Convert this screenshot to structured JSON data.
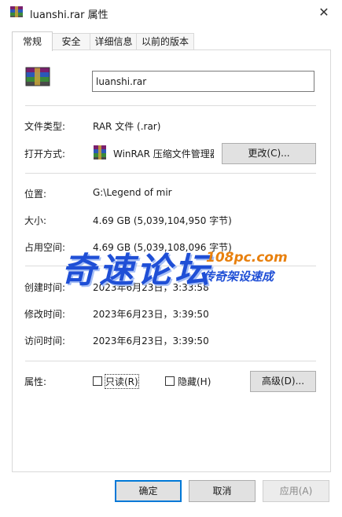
{
  "window": {
    "title": "luanshi.rar 属性",
    "close_glyph": "✕"
  },
  "tabs": [
    {
      "label": "常规",
      "active": true
    },
    {
      "label": "安全",
      "active": false
    },
    {
      "label": "详细信息",
      "active": false
    },
    {
      "label": "以前的版本",
      "active": false
    }
  ],
  "general": {
    "file_name": "luanshi.rar",
    "file_type_label": "文件类型:",
    "file_type_value": "RAR 文件 (.rar)",
    "open_with_label": "打开方式:",
    "open_with_value": "WinRAR 压缩文件管理器",
    "change_button": "更改(C)...",
    "location_label": "位置:",
    "location_value": "G:\\Legend of mir",
    "size_label": "大小:",
    "size_value": "4.69 GB (5,039,104,950 字节)",
    "size_on_disk_label": "占用空间:",
    "size_on_disk_value": "4.69 GB (5,039,108,096 字节)",
    "created_label": "创建时间:",
    "created_value": "2023年6月23日，3:33:58",
    "modified_label": "修改时间:",
    "modified_value": "2023年6月23日，3:39:50",
    "accessed_label": "访问时间:",
    "accessed_value": "2023年6月23日，3:39:50",
    "attributes_label": "属性:",
    "readonly_label": "只读(R)",
    "readonly_checked": false,
    "hidden_label": "隐藏(H)",
    "hidden_checked": false,
    "advanced_button": "高级(D)..."
  },
  "footer": {
    "ok": "确定",
    "cancel": "取消",
    "apply": "应用(A)"
  },
  "watermark": {
    "main": "奇速论坛",
    "site": "108pc.com",
    "sub": "传奇架设速成"
  },
  "colors": {
    "accent": "#0078d7",
    "watermark_blue": "#1f4fd6",
    "watermark_orange": "#e8800e"
  },
  "icons": {
    "title": "winrar-archive-icon",
    "file": "winrar-archive-icon",
    "app": "winrar-app-icon"
  }
}
